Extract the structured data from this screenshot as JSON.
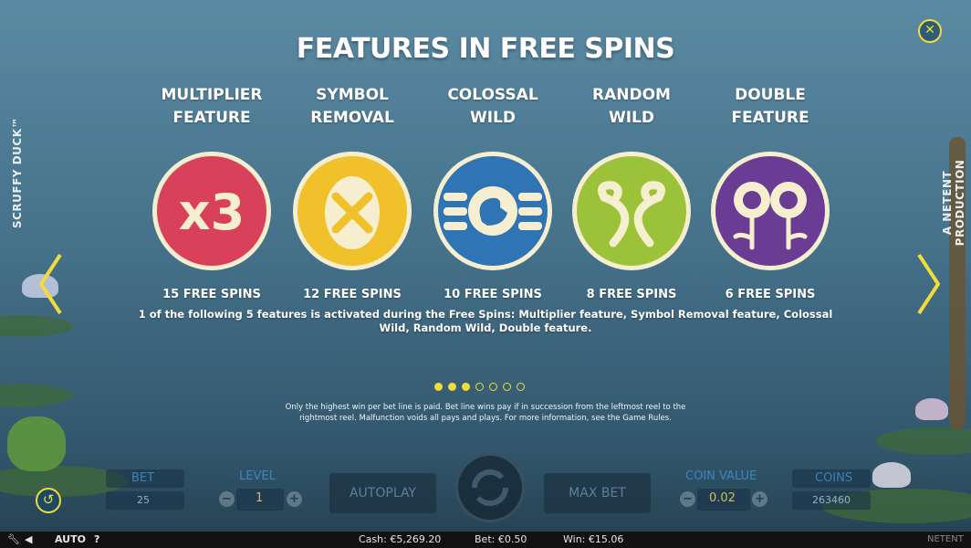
{
  "title": "FEATURES IN FREE SPINS",
  "brand": {
    "left": "SCRUFFY DUCK™",
    "right": "A NETENT PRODUCTION"
  },
  "features": [
    {
      "name_line1": "MULTIPLIER",
      "name_line2": "FEATURE",
      "free_spins": "15 FREE SPINS",
      "color": "#d9415a",
      "icon": "x3-multiplier-icon",
      "icon_text": "x3"
    },
    {
      "name_line1": "SYMBOL",
      "name_line2": "REMOVAL",
      "free_spins": "12 FREE SPINS",
      "color": "#f0c12a",
      "icon": "egg-cross-icon"
    },
    {
      "name_line1": "COLOSSAL",
      "name_line2": "WILD",
      "free_spins": "10 FREE SPINS",
      "color": "#2f74b4",
      "icon": "swan-icon"
    },
    {
      "name_line1": "RANDOM",
      "name_line2": "WILD",
      "free_spins": "8 FREE SPINS",
      "color": "#9cc23a",
      "icon": "intertwined-swans-icon"
    },
    {
      "name_line1": "DOUBLE",
      "name_line2": "FEATURE",
      "free_spins": "6 FREE SPINS",
      "color": "#6a3c94",
      "icon": "double-flower-icon"
    }
  ],
  "description": "1 of the following 5 features is activated during the Free Spins: Multiplier feature, Symbol Removal feature, Colossal Wild, Random Wild, Double feature.",
  "pagination": {
    "total": 7,
    "active": 3
  },
  "rules_text": "Only the highest win per bet line is paid. Bet line wins pay if in succession from the leftmost reel to the rightmost reel. Malfunction voids all pays and plays. For more information, see the Game Rules.",
  "controls": {
    "bet_label": "BET",
    "bet_value": "25",
    "level_label": "LEVEL",
    "level_value": "1",
    "autoplay_label": "AUTOPLAY",
    "max_bet_label": "MAX BET",
    "coin_value_label": "COIN VALUE",
    "coin_value": "0.02",
    "coins_label": "COINS",
    "coins_value": "263460"
  },
  "status_bar": {
    "auto_label": "AUTO",
    "help_label": "?",
    "cash": "Cash: €5,269.20",
    "bet": "Bet: €0.50",
    "win": "Win: €15.06",
    "logo": "NETENT"
  },
  "colors": {
    "accent_yellow": "#f1dc3b",
    "cream": "#f6efcf"
  }
}
